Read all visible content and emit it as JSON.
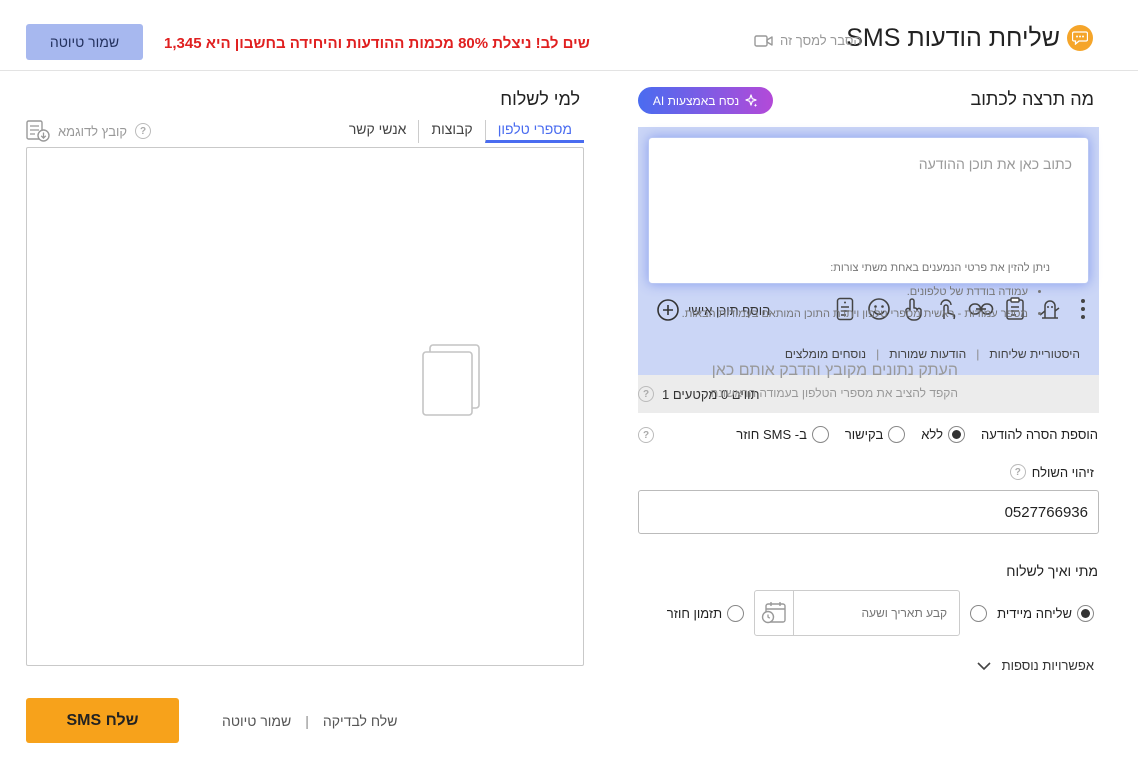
{
  "header": {
    "title": "שליחת הודעות SMS",
    "explain_link": "הסבר למסך זה",
    "warning": "שים לב! ניצלת 80% מכמות ההודעות והיחידה בחשבון היא 1,345",
    "save_draft": "שמור טיוטה"
  },
  "compose": {
    "label": "מה תרצה לכתוב",
    "ai_button": "נסח באמצעות AI",
    "placeholder": "כתוב כאן את תוכן ההודעה",
    "add_personal": "הוסף תוכן אישי",
    "tools": [
      "sms-template-icon",
      "emoji-icon",
      "touch-icon",
      "hand-point-icon",
      "link-icon",
      "clipboard-icon",
      "robot-icon",
      "more-vertical-icon"
    ],
    "links": [
      "היסטוריית שליחות",
      "הודעות שמורות",
      "נוסחים מומלצים"
    ],
    "counter": "תווים 0 מקטעים 1"
  },
  "unsubscribe": {
    "label": "הוספת הסרה להודעה",
    "options": [
      "ללא",
      "בקישור",
      "ב- SMS חוזר"
    ],
    "selected": "ללא"
  },
  "sender": {
    "label": "זיהוי השולח",
    "value": "0527766936"
  },
  "schedule": {
    "label": "מתי ואיך לשלוח",
    "immediate": "שליחה מיידית",
    "date_placeholder": "קבע תאריך ושעה",
    "recurring": "תזמון חוזר",
    "more_options": "אפשרויות נוספות"
  },
  "recipients": {
    "label": "למי לשלוח",
    "tabs": [
      "מספרי טלפון",
      "קבוצות",
      "אנשי קשר"
    ],
    "active_tab": "מספרי טלפון",
    "sample_file": "קובץ לדוגמא",
    "instructions": "ניתן להזין את פרטי הנמענים באחת משתי צורות:",
    "bullets": [
      "עמודה בודדת של טלפונים.",
      "מספר עמודות - ראשית מספרי טלפון ויתרת התוכן המותאם בעמודות הבאות."
    ],
    "paste_title": "העתק נתונים מקובץ והדבק אותם כאן",
    "paste_hint": "הקפד להציב את מספרי הטלפון בעמודה הראשונה"
  },
  "footer": {
    "send": "שלח SMS",
    "save_draft": "שמור טיוטה",
    "send_test": "שלח לבדיקה"
  },
  "colors": {
    "accent": "#4a6cf0",
    "send": "#f7a21b",
    "warning": "#e02020"
  }
}
